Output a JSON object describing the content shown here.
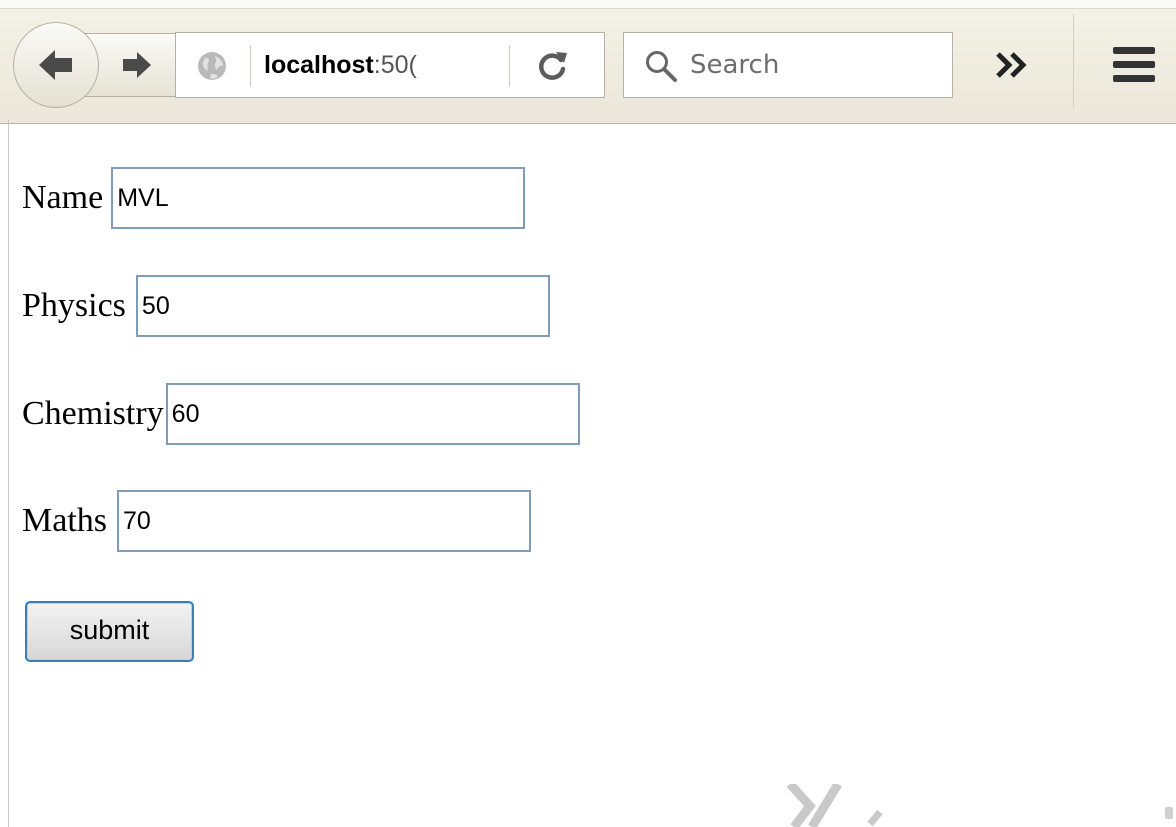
{
  "browser": {
    "url": {
      "host": "localhost",
      "port": ":50("
    },
    "search": {
      "placeholder": "Search"
    }
  },
  "form": {
    "fields": [
      {
        "label": "Name",
        "value": "MVL"
      },
      {
        "label": "Physics",
        "value": "50"
      },
      {
        "label": "Chemistry",
        "value": "60"
      },
      {
        "label": "Maths",
        "value": "70"
      }
    ],
    "submit_label": "submit"
  },
  "colors": {
    "toolbar": "#ebe7da",
    "input_border": "#7f9db9",
    "submit_border": "#3c7fb1"
  },
  "icons": {
    "back": "back-arrow-icon",
    "forward": "forward-arrow-icon",
    "site": "globe-icon",
    "reload": "reload-icon",
    "search": "magnifier-icon",
    "overflow": "double-chevron-icon",
    "menu": "hamburger-menu-icon"
  }
}
